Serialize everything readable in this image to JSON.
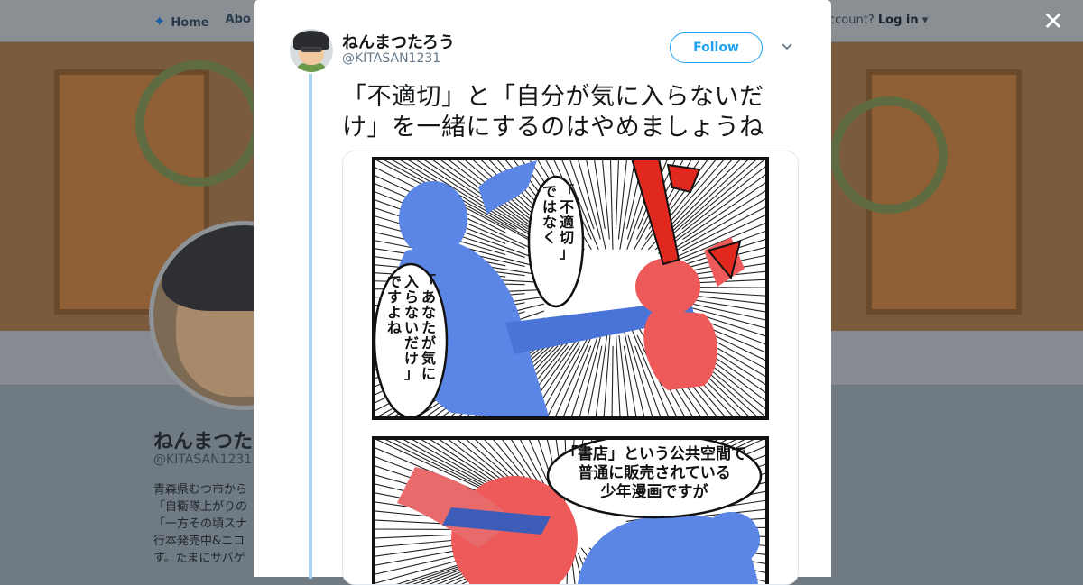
{
  "background": {
    "nav": {
      "home_label": "Home",
      "about_label": "Abo"
    },
    "account": {
      "prompt": "ccount?",
      "login_label": "Log in"
    },
    "profile": {
      "name": "ねんまつた",
      "handle": "@KITASAN1231",
      "bio_lines": [
        "青森県むつ市から",
        "「自衛隊上がりの",
        "「一方その頃スナ",
        "行本発売中&ニコ",
        "す。たまにサバゲ"
      ]
    }
  },
  "modal": {
    "tweet": {
      "author_name": "ねんまつたろう",
      "author_handle": "@KITASAN1231",
      "follow_label": "Follow",
      "text_line1": "「不適切」と「自分が気に入らないだ",
      "text_line2": "け」を一緒にするのはやめましょうね"
    },
    "comic": {
      "panel1_bubble_left": [
        "「あなたが気に",
        "入らないだけ」",
        "ですよね"
      ],
      "panel1_bubble_right": [
        "「不適切」",
        "ではなく"
      ],
      "panel2_bubble": [
        "「書店」という公共空間で",
        "普通に販売されている",
        "少年漫画ですが"
      ]
    }
  },
  "icons": {
    "close": "close-icon",
    "caret": "chevron-down-icon",
    "bird": "twitter-bird-icon"
  },
  "colors": {
    "accent": "#1da1f2",
    "thread_line": "#a6d4f2",
    "blue_figure": "#5b86e6",
    "red_figure": "#ee5a5a",
    "impact_red": "#e0281e"
  }
}
